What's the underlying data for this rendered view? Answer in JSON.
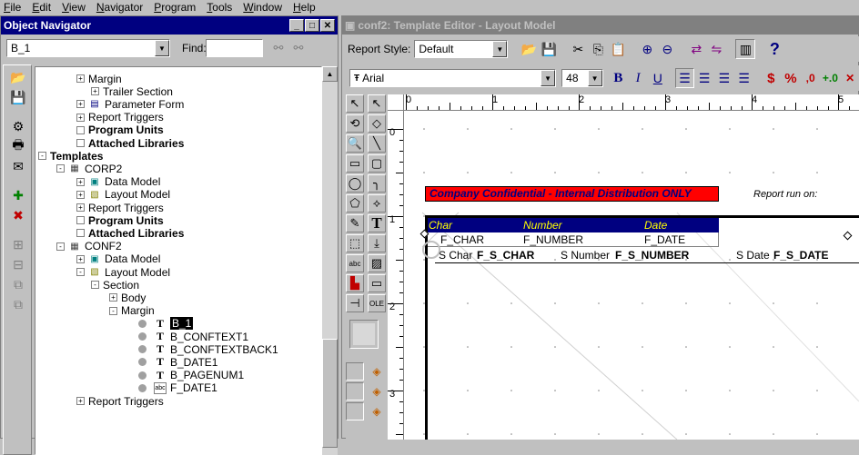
{
  "menu": [
    "File",
    "Edit",
    "View",
    "Navigator",
    "Program",
    "Tools",
    "Window",
    "Help"
  ],
  "navigator": {
    "title": "Object Navigator",
    "selector_value": "B_1",
    "find_label": "Find:",
    "find_value": "",
    "tree": [
      {
        "label": "Margin",
        "bold": false,
        "exp": "+",
        "icon": ""
      },
      {
        "label": "Trailer Section",
        "bold": false,
        "exp": "+",
        "icon": ""
      },
      {
        "label": "Parameter Form",
        "bold": false,
        "exp": "+",
        "icon": "pf"
      },
      {
        "label": "Report Triggers",
        "bold": false,
        "exp": "+",
        "icon": ""
      },
      {
        "label": "Program Units",
        "bold": true,
        "exp": "",
        "icon": ""
      },
      {
        "label": "Attached Libraries",
        "bold": true,
        "exp": "",
        "icon": ""
      },
      {
        "label": "Templates",
        "bold": true,
        "exp": "-",
        "icon": ""
      },
      {
        "label": "CORP2",
        "bold": false,
        "exp": "-",
        "icon": "tpl"
      },
      {
        "label": "Data Model",
        "bold": false,
        "exp": "+",
        "icon": "dm"
      },
      {
        "label": "Layout Model",
        "bold": false,
        "exp": "+",
        "icon": "lm"
      },
      {
        "label": "Report Triggers",
        "bold": false,
        "exp": "+",
        "icon": ""
      },
      {
        "label": "Program Units",
        "bold": true,
        "exp": "",
        "icon": ""
      },
      {
        "label": "Attached Libraries",
        "bold": true,
        "exp": "",
        "icon": ""
      },
      {
        "label": "CONF2",
        "bold": false,
        "exp": "-",
        "icon": "tpl"
      },
      {
        "label": "Data Model",
        "bold": false,
        "exp": "+",
        "icon": "dm"
      },
      {
        "label": "Layout Model",
        "bold": false,
        "exp": "-",
        "icon": "lm"
      },
      {
        "label": "Section",
        "bold": false,
        "exp": "-",
        "icon": ""
      },
      {
        "label": "Body",
        "bold": false,
        "exp": "+",
        "icon": ""
      },
      {
        "label": "Margin",
        "bold": false,
        "exp": "-",
        "icon": ""
      },
      {
        "label": "B_1",
        "bold": false,
        "exp": "",
        "icon": "T",
        "selected": true
      },
      {
        "label": "B_CONFTEXT1",
        "bold": false,
        "exp": "",
        "icon": "T"
      },
      {
        "label": "B_CONFTEXTBACK1",
        "bold": false,
        "exp": "",
        "icon": "T"
      },
      {
        "label": "B_DATE1",
        "bold": false,
        "exp": "",
        "icon": "T"
      },
      {
        "label": "B_PAGENUM1",
        "bold": false,
        "exp": "",
        "icon": "T"
      },
      {
        "label": "F_DATE1",
        "bold": false,
        "exp": "",
        "icon": "abc"
      },
      {
        "label": "Report Triggers",
        "bold": false,
        "exp": "+",
        "icon": ""
      }
    ]
  },
  "editor": {
    "title": "conf2: Template Editor - Layout Model",
    "report_style_label": "Report Style:",
    "report_style_value": "Default",
    "font_value": "Arial",
    "size_value": "48",
    "bold_label": "B",
    "italic_label": "I",
    "underline_label": "U",
    "currency_label": "$",
    "percent_label": "%",
    "comma_label": ",0",
    "ruler_marks": [
      "0",
      "1",
      "2",
      "3",
      "4",
      "5"
    ],
    "vruler_marks": [
      "0",
      "1",
      "2",
      "3"
    ],
    "canvas": {
      "confidential": "Company Confidential - Internal Distribution ONLY",
      "report_run_on": "Report run on:",
      "headers": [
        "Char",
        "Number",
        "Date"
      ],
      "fields": [
        "F_CHAR",
        "F_NUMBER",
        "F_DATE"
      ],
      "sum_labels": [
        "S Char",
        "S Number",
        "S Date"
      ],
      "sum_fields": [
        "F_S_CHAR",
        "F_S_NUMBER",
        "F_S_DATE"
      ],
      "colors": {
        "conf_bg": "#ff0000",
        "header_bg": "#000080",
        "header_fg": "#ffff00"
      }
    }
  }
}
